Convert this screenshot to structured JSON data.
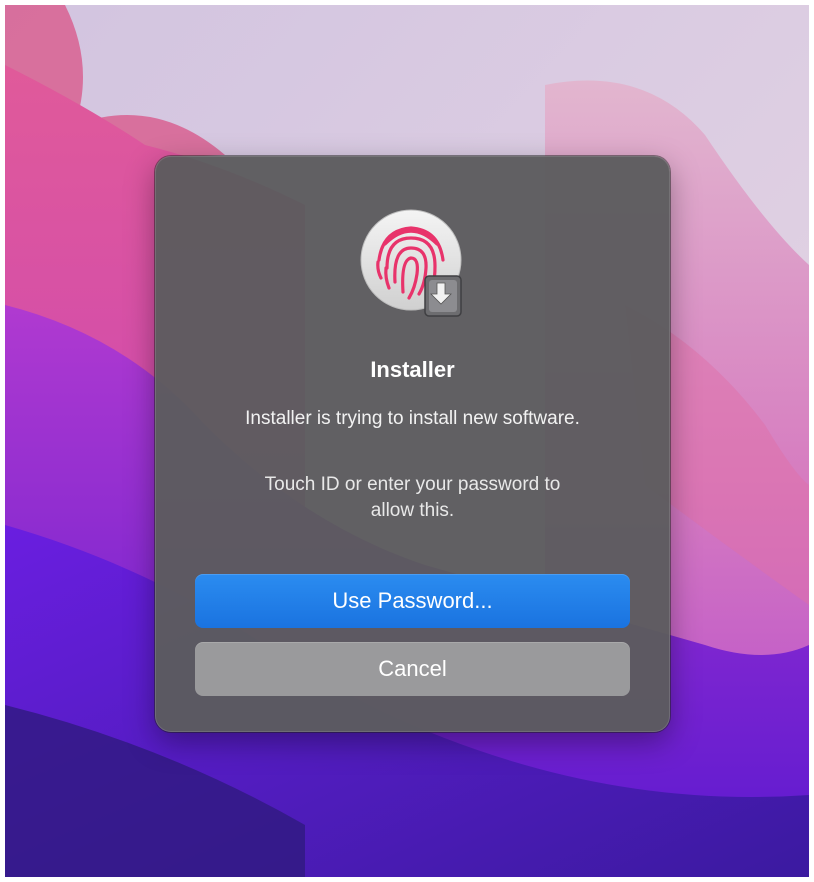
{
  "dialog": {
    "app_icon": "fingerprint-icon",
    "badge_icon": "installer-icon",
    "title": "Installer",
    "message": "Installer is trying to install new software.",
    "info_line1": "Touch ID or enter your password to",
    "info_line2": "allow this.",
    "primary_button_label": "Use Password...",
    "cancel_button_label": "Cancel"
  },
  "colors": {
    "primary_button": "#1a73e0",
    "cancel_button": "#9a9a9c",
    "dialog_background": "#5c5c5e",
    "fingerprint": "#e8336b"
  }
}
